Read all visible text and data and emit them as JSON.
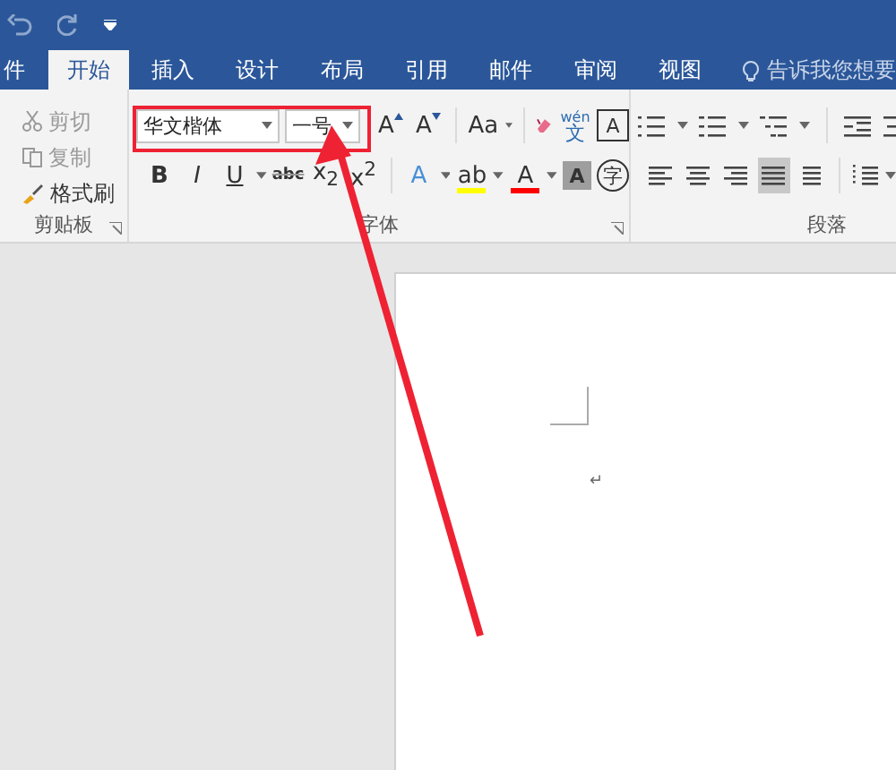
{
  "tabs": [
    {
      "label": "件",
      "selected": false
    },
    {
      "label": "开始",
      "selected": true
    },
    {
      "label": "插入",
      "selected": false
    },
    {
      "label": "设计",
      "selected": false
    },
    {
      "label": "布局",
      "selected": false
    },
    {
      "label": "引用",
      "selected": false
    },
    {
      "label": "邮件",
      "selected": false
    },
    {
      "label": "审阅",
      "selected": false
    },
    {
      "label": "视图",
      "selected": false
    }
  ],
  "tell_me": "告诉我您想要",
  "clipboard": {
    "label": "剪贴板",
    "buttons": [
      {
        "kind": "cut",
        "label": "剪切",
        "disabled": true
      },
      {
        "kind": "copy",
        "label": "复制",
        "disabled": true
      },
      {
        "kind": "painter",
        "label": "格式刷",
        "disabled": false
      }
    ]
  },
  "font": {
    "label": "字体",
    "font_name": "华文楷体",
    "font_size": "一号",
    "row1": [
      {
        "kind": "grow",
        "text": "A"
      },
      {
        "kind": "shrink",
        "text": "A"
      },
      {
        "kind": "case",
        "text": "Aa"
      },
      {
        "kind": "eraser"
      },
      {
        "kind": "phonetic",
        "text": "wén",
        "sub": "文"
      },
      {
        "kind": "border",
        "text": "A"
      }
    ],
    "row2": [
      {
        "kind": "bold",
        "text": "B"
      },
      {
        "kind": "italic",
        "text": "I"
      },
      {
        "kind": "underline",
        "text": "U"
      },
      {
        "kind": "strike",
        "text": "abc"
      },
      {
        "kind": "script",
        "text": "x$_{2}$"
      },
      {
        "kind": "script",
        "text": "x$^{2}$"
      },
      {
        "kind": "effects",
        "text": "A"
      },
      {
        "kind": "highlight",
        "text": "ab"
      },
      {
        "kind": "color",
        "text": "A"
      },
      {
        "kind": "shade",
        "text": "A"
      },
      {
        "kind": "enclose",
        "text": "字"
      }
    ]
  },
  "paragraph": {
    "label": "段落",
    "alignments": [
      {
        "selected": false
      },
      {
        "selected": false
      },
      {
        "selected": false
      },
      {
        "selected": true
      },
      {
        "selected": false
      }
    ]
  },
  "document": {
    "paragraph_mark": "↵"
  }
}
